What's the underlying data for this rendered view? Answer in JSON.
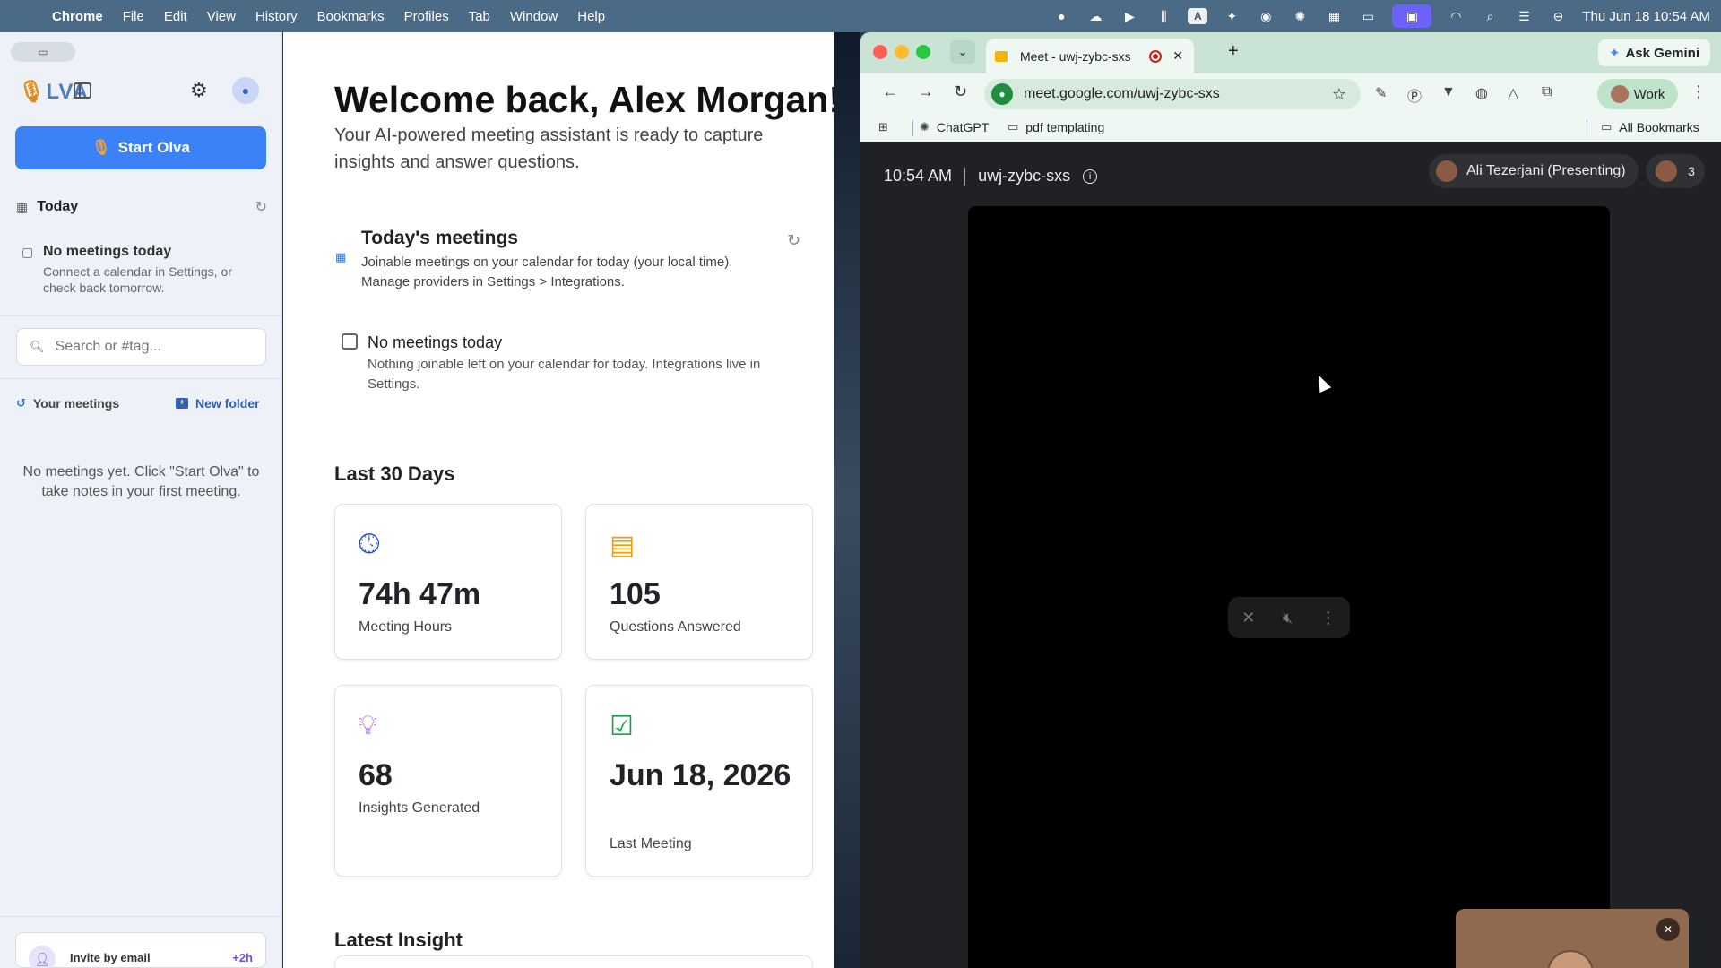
{
  "menubar": {
    "app_name": "Chrome",
    "items": [
      "File",
      "Edit",
      "View",
      "History",
      "Bookmarks",
      "Profiles",
      "Tab",
      "Window",
      "Help"
    ],
    "clock": "Thu Jun 18  10:54 AM"
  },
  "olva": {
    "logo": "LVA",
    "start_label": "Start Olva",
    "today_label": "Today",
    "sidebar_empty_title": "No meetings today",
    "sidebar_empty_desc": "Connect a calendar in Settings, or check back tomorrow.",
    "search_placeholder": "Search or #tag...",
    "your_meetings_label": "Your meetings",
    "new_folder_label": "New folder",
    "no_meetings_msg": "No meetings yet. Click \"Start Olva\" to take notes in your first meeting.",
    "invite_label": "Invite by email",
    "invite_bonus": "+2h",
    "welcome": "Welcome back, Alex Morgan!",
    "subtitle": "Your AI-powered meeting assistant is ready to capture insights and answer questions.",
    "todays_meetings_title": "Today's meetings",
    "todays_meetings_desc": "Joinable meetings on your calendar for today (your local time). Manage providers in Settings > Integrations.",
    "no_meetings_title": "No meetings today",
    "no_meetings_desc": "Nothing joinable left on your calendar for today. Integrations live in Settings.",
    "last30_title": "Last 30 Days",
    "stats": [
      {
        "value": "74h 47m",
        "label": "Meeting Hours",
        "icon": "clock-icon",
        "color": "#1d4ed8"
      },
      {
        "value": "105",
        "label": "Questions Answered",
        "icon": "chat-icon",
        "color": "#f59e0b"
      },
      {
        "value": "68",
        "label": "Insights Generated",
        "icon": "lightbulb-icon",
        "color": "#9333ea"
      },
      {
        "value": "Jun 18, 2026",
        "label": "Last Meeting",
        "icon": "calendar-check-icon",
        "color": "#16a34a"
      }
    ],
    "latest_insight_title": "Latest Insight"
  },
  "chrome": {
    "tab_title": "Meet - uwj-zybc-sxs",
    "ask_gemini": "Ask Gemini",
    "url": "meet.google.com/uwj-zybc-sxs",
    "profile": "Work",
    "bookmarks": [
      "ChatGPT",
      "pdf templating"
    ],
    "all_bookmarks": "All Bookmarks"
  },
  "meet": {
    "time": "10:54 AM",
    "code": "uwj-zybc-sxs",
    "presenter": "Ali Tezerjani (Presenting)",
    "participants": "3"
  }
}
